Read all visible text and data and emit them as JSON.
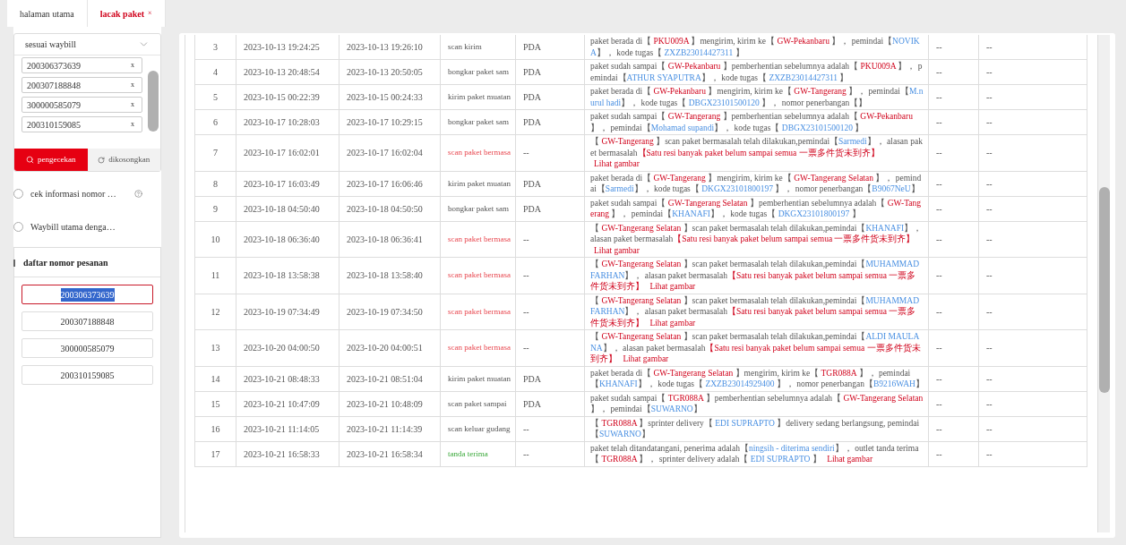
{
  "tabs": [
    {
      "label": "halaman utama",
      "selected": false
    },
    {
      "label": "lacak paket",
      "selected": true,
      "close": "×"
    }
  ],
  "sidebar": {
    "query_mode": "sesuai waybill",
    "waybill_tags": [
      {
        "label": "200306373639",
        "remove": "x"
      },
      {
        "label": "200307188848",
        "remove": "x"
      },
      {
        "label": "300000585079",
        "remove": "x"
      },
      {
        "label": "200310159085",
        "remove": "x"
      }
    ],
    "search_button": "pengecekan",
    "clear_button": "dikosongkan",
    "options": [
      {
        "label": "cek informasi nomor …",
        "selected": false,
        "help": true
      },
      {
        "label": "Waybill utama denga…",
        "selected": false,
        "help": false
      }
    ],
    "order_list": {
      "title": "daftar nomor pesanan",
      "items": [
        {
          "label": "200306373639",
          "selected": true
        },
        {
          "label": "200307188848",
          "selected": false
        },
        {
          "label": "300000585079",
          "selected": false
        },
        {
          "label": "200310159085",
          "selected": false
        }
      ]
    }
  },
  "table": {
    "rows": [
      {
        "column_1": "3",
        "column_2": "2023-10-13 19:24:25",
        "column_3": "2023-10-13 19:26:10",
        "column_4": {
          "text": "scan kirim",
          "kind": "normal"
        },
        "column_5": "PDA",
        "column_6": [
          {
            "kind": "text",
            "text": "paket berada di【 "
          },
          {
            "kind": "place",
            "text": "PKU009A"
          },
          {
            "kind": "text",
            "text": " 】mengirim, kirim ke【 "
          },
          {
            "kind": "place",
            "text": "GW-Pekanbaru"
          },
          {
            "kind": "text",
            "text": " 】， pemindai【"
          },
          {
            "kind": "person",
            "text": "NOVIKA"
          },
          {
            "kind": "text",
            "text": "】， kode tugas【 "
          },
          {
            "kind": "person",
            "text": "ZXZB23014427311"
          },
          {
            "kind": "text",
            "text": " 】"
          }
        ],
        "column_7": "--",
        "column_8": "--"
      },
      {
        "column_1": "4",
        "column_2": "2023-10-13 20:48:54",
        "column_3": "2023-10-13 20:50:05",
        "column_4": {
          "text": "bongkar paket sam",
          "kind": "normal"
        },
        "column_5": "PDA",
        "column_6": [
          {
            "kind": "text",
            "text": "paket sudah sampai【 "
          },
          {
            "kind": "place",
            "text": "GW-Pekanbaru"
          },
          {
            "kind": "text",
            "text": " 】pemberhentian sebelumnya adalah【 "
          },
          {
            "kind": "place",
            "text": "PKU009A"
          },
          {
            "kind": "text",
            "text": " 】， pemindai【"
          },
          {
            "kind": "person",
            "text": "ATHUR SYAPUTRA"
          },
          {
            "kind": "text",
            "text": "】， kode tugas【 "
          },
          {
            "kind": "person",
            "text": "ZXZB23014427311"
          },
          {
            "kind": "text",
            "text": " 】"
          }
        ],
        "column_7": "--",
        "column_8": "--"
      },
      {
        "column_1": "5",
        "column_2": "2023-10-15 00:22:39",
        "column_3": "2023-10-15 00:24:33",
        "column_4": {
          "text": "kirim paket muatan",
          "kind": "normal"
        },
        "column_5": "PDA",
        "column_6": [
          {
            "kind": "text",
            "text": "paket berada di【 "
          },
          {
            "kind": "place",
            "text": "GW-Pekanbaru"
          },
          {
            "kind": "text",
            "text": " 】mengirim, kirim ke【 "
          },
          {
            "kind": "place",
            "text": "GW-Tangerang"
          },
          {
            "kind": "text",
            "text": " 】， pemindai【"
          },
          {
            "kind": "person",
            "text": "M.nurul hadi"
          },
          {
            "kind": "text",
            "text": "】， kode tugas【 "
          },
          {
            "kind": "person",
            "text": "DBGX23101500120"
          },
          {
            "kind": "text",
            "text": " 】， nomor penerbangan【】"
          }
        ],
        "column_7": "--",
        "column_8": "--"
      },
      {
        "column_1": "6",
        "column_2": "2023-10-17 10:28:03",
        "column_3": "2023-10-17 10:29:15",
        "column_4": {
          "text": "bongkar paket sam",
          "kind": "normal"
        },
        "column_5": "PDA",
        "column_6": [
          {
            "kind": "text",
            "text": "paket sudah sampai【 "
          },
          {
            "kind": "place",
            "text": "GW-Tangerang"
          },
          {
            "kind": "text",
            "text": " 】pemberhentian sebelumnya adalah【 "
          },
          {
            "kind": "place",
            "text": "GW-Pekanbaru"
          },
          {
            "kind": "text",
            "text": " 】， pemindai【"
          },
          {
            "kind": "person",
            "text": "Mohamad supandi"
          },
          {
            "kind": "text",
            "text": "】， kode tugas【 "
          },
          {
            "kind": "person",
            "text": "DBGX23101500120"
          },
          {
            "kind": "text",
            "text": " 】"
          }
        ],
        "column_7": "--",
        "column_8": "--"
      },
      {
        "column_1": "7",
        "column_2": "2023-10-17 16:02:01",
        "column_3": "2023-10-17 16:02:04",
        "column_4": {
          "text": "scan paket bermasa",
          "kind": "problem"
        },
        "column_5": "--",
        "column_6": [
          {
            "kind": "text",
            "text": "【 "
          },
          {
            "kind": "place",
            "text": "GW-Tangerang"
          },
          {
            "kind": "text",
            "text": " 】scan paket bermasalah telah dilakukan,pemindai【"
          },
          {
            "kind": "person",
            "text": "Sarmedi"
          },
          {
            "kind": "text",
            "text": "】， alasan paket bermasalah"
          },
          {
            "kind": "reason",
            "text": "【Satu resi banyak paket belum sampai semua 一票多件货未到齐】"
          },
          {
            "kind": "link",
            "text": "Lihat gambar"
          }
        ],
        "column_7": "--",
        "column_8": "--"
      },
      {
        "column_1": "8",
        "column_2": "2023-10-17 16:03:49",
        "column_3": "2023-10-17 16:06:46",
        "column_4": {
          "text": "kirim paket muatan",
          "kind": "normal"
        },
        "column_5": "PDA",
        "column_6": [
          {
            "kind": "text",
            "text": "paket berada di【 "
          },
          {
            "kind": "place",
            "text": "GW-Tangerang"
          },
          {
            "kind": "text",
            "text": " 】mengirim, kirim ke【 "
          },
          {
            "kind": "place",
            "text": "GW-Tangerang Selatan"
          },
          {
            "kind": "text",
            "text": " 】， pemindai【"
          },
          {
            "kind": "person",
            "text": "Sarmedi"
          },
          {
            "kind": "text",
            "text": "】， kode tugas【 "
          },
          {
            "kind": "person",
            "text": "DKGX23101800197"
          },
          {
            "kind": "text",
            "text": " 】， nomor penerbangan【"
          },
          {
            "kind": "person",
            "text": "B9067NeU"
          },
          {
            "kind": "text",
            "text": "】"
          }
        ],
        "column_7": "--",
        "column_8": "--"
      },
      {
        "column_1": "9",
        "column_2": "2023-10-18 04:50:40",
        "column_3": "2023-10-18 04:50:50",
        "column_4": {
          "text": "bongkar paket sam",
          "kind": "normal"
        },
        "column_5": "PDA",
        "column_6": [
          {
            "kind": "text",
            "text": "paket sudah sampai【 "
          },
          {
            "kind": "place",
            "text": "GW-Tangerang Selatan"
          },
          {
            "kind": "text",
            "text": " 】pemberhentian sebelumnya adalah【 "
          },
          {
            "kind": "place",
            "text": "GW-Tangerang"
          },
          {
            "kind": "text",
            "text": " 】， pemindai【"
          },
          {
            "kind": "person",
            "text": "KHANAFI"
          },
          {
            "kind": "text",
            "text": "】， kode tugas【 "
          },
          {
            "kind": "person",
            "text": "DKGX23101800197"
          },
          {
            "kind": "text",
            "text": " 】"
          }
        ],
        "column_7": "--",
        "column_8": "--"
      },
      {
        "column_1": "10",
        "column_2": "2023-10-18 06:36:40",
        "column_3": "2023-10-18 06:36:41",
        "column_4": {
          "text": "scan paket bermasa",
          "kind": "problem"
        },
        "column_5": "--",
        "column_6": [
          {
            "kind": "text",
            "text": "【 "
          },
          {
            "kind": "place",
            "text": "GW-Tangerang Selatan"
          },
          {
            "kind": "text",
            "text": " 】scan paket bermasalah telah dilakukan,pemindai【"
          },
          {
            "kind": "person",
            "text": "KHANAFI"
          },
          {
            "kind": "text",
            "text": "】， alasan paket bermasalah"
          },
          {
            "kind": "reason",
            "text": "【Satu resi banyak paket belum sampai semua 一票多件货未到齐】"
          },
          {
            "kind": "link",
            "text": "Lihat gambar"
          }
        ],
        "column_7": "--",
        "column_8": "--"
      },
      {
        "column_1": "11",
        "column_2": "2023-10-18 13:58:38",
        "column_3": "2023-10-18 13:58:40",
        "column_4": {
          "text": "scan paket bermasa",
          "kind": "problem"
        },
        "column_5": "--",
        "column_6": [
          {
            "kind": "text",
            "text": "【 "
          },
          {
            "kind": "place",
            "text": "GW-Tangerang Selatan"
          },
          {
            "kind": "text",
            "text": " 】scan paket bermasalah telah dilakukan,pemindai【"
          },
          {
            "kind": "person",
            "text": "MUHAMMAD FARHAN"
          },
          {
            "kind": "text",
            "text": "】， alasan paket bermasalah"
          },
          {
            "kind": "reason",
            "text": "【Satu resi banyak paket belum sampai semua 一票多件货未到齐】"
          },
          {
            "kind": "link",
            "text": "Lihat gambar"
          }
        ],
        "column_7": "--",
        "column_8": "--"
      },
      {
        "column_1": "12",
        "column_2": "2023-10-19 07:34:49",
        "column_3": "2023-10-19 07:34:50",
        "column_4": {
          "text": "scan paket bermasa",
          "kind": "problem"
        },
        "column_5": "--",
        "column_6": [
          {
            "kind": "text",
            "text": "【 "
          },
          {
            "kind": "place",
            "text": "GW-Tangerang Selatan"
          },
          {
            "kind": "text",
            "text": " 】scan paket bermasalah telah dilakukan,pemindai【"
          },
          {
            "kind": "person",
            "text": "MUHAMMAD FARHAN"
          },
          {
            "kind": "text",
            "text": "】， alasan paket bermasalah"
          },
          {
            "kind": "reason",
            "text": "【Satu resi banyak paket belum sampai semua 一票多件货未到齐】"
          },
          {
            "kind": "link",
            "text": "Lihat gambar"
          }
        ],
        "column_7": "--",
        "column_8": "--"
      },
      {
        "column_1": "13",
        "column_2": "2023-10-20 04:00:50",
        "column_3": "2023-10-20 04:00:51",
        "column_4": {
          "text": "scan paket bermasa",
          "kind": "problem"
        },
        "column_5": "--",
        "column_6": [
          {
            "kind": "text",
            "text": "【 "
          },
          {
            "kind": "place",
            "text": "GW-Tangerang Selatan"
          },
          {
            "kind": "text",
            "text": " 】scan paket bermasalah telah dilakukan,pemindai【"
          },
          {
            "kind": "person",
            "text": "ALDI MAULANA"
          },
          {
            "kind": "text",
            "text": "】， alasan paket bermasalah"
          },
          {
            "kind": "reason",
            "text": "【Satu resi banyak paket belum sampai semua 一票多件货未到齐】"
          },
          {
            "kind": "link",
            "text": "Lihat gambar"
          }
        ],
        "column_7": "--",
        "column_8": "--"
      },
      {
        "column_1": "14",
        "column_2": "2023-10-21 08:48:33",
        "column_3": "2023-10-21 08:51:04",
        "column_4": {
          "text": "kirim paket muatan",
          "kind": "normal"
        },
        "column_5": "PDA",
        "column_6": [
          {
            "kind": "text",
            "text": "paket berada di【 "
          },
          {
            "kind": "place",
            "text": "GW-Tangerang Selatan"
          },
          {
            "kind": "text",
            "text": " 】mengirim, kirim ke【 "
          },
          {
            "kind": "place",
            "text": "TGR088A"
          },
          {
            "kind": "text",
            "text": " 】， pemindai【"
          },
          {
            "kind": "person",
            "text": "KHANAFI"
          },
          {
            "kind": "text",
            "text": "】， kode tugas【 "
          },
          {
            "kind": "person",
            "text": "ZXZB23014929400"
          },
          {
            "kind": "text",
            "text": " 】， nomor penerbangan【"
          },
          {
            "kind": "person",
            "text": "B9216WAH"
          },
          {
            "kind": "text",
            "text": "】"
          }
        ],
        "column_7": "--",
        "column_8": "--"
      },
      {
        "column_1": "15",
        "column_2": "2023-10-21 10:47:09",
        "column_3": "2023-10-21 10:48:09",
        "column_4": {
          "text": "scan paket sampai",
          "kind": "normal"
        },
        "column_5": "PDA",
        "column_6": [
          {
            "kind": "text",
            "text": "paket sudah sampai【 "
          },
          {
            "kind": "place",
            "text": "TGR088A"
          },
          {
            "kind": "text",
            "text": " 】pemberhentian sebelumnya adalah【 "
          },
          {
            "kind": "place",
            "text": "GW-Tangerang Selatan"
          },
          {
            "kind": "text",
            "text": " 】， pemindai【"
          },
          {
            "kind": "person",
            "text": "SUWARNO"
          },
          {
            "kind": "text",
            "text": "】"
          }
        ],
        "column_7": "--",
        "column_8": "--"
      },
      {
        "column_1": "16",
        "column_2": "2023-10-21 11:14:05",
        "column_3": "2023-10-21 11:14:39",
        "column_4": {
          "text": "scan keluar gudang",
          "kind": "normal"
        },
        "column_5": "--",
        "column_6": [
          {
            "kind": "text",
            "text": "【 "
          },
          {
            "kind": "place",
            "text": "TGR088A"
          },
          {
            "kind": "text",
            "text": " 】sprinter delivery【 "
          },
          {
            "kind": "person",
            "text": "EDI SUPRAPTO"
          },
          {
            "kind": "text",
            "text": " 】delivery sedang berlangsung, pemindai【"
          },
          {
            "kind": "person",
            "text": "SUWARNO"
          },
          {
            "kind": "text",
            "text": "】"
          }
        ],
        "column_7": "--",
        "column_8": "--"
      },
      {
        "column_1": "17",
        "column_2": "2023-10-21 16:58:33",
        "column_3": "2023-10-21 16:58:34",
        "column_4": {
          "text": "tanda terima",
          "kind": "signed"
        },
        "column_5": "--",
        "column_6": [
          {
            "kind": "text",
            "text": "paket telah ditandatangani, penerima adalah【"
          },
          {
            "kind": "person",
            "text": "ningsih - diterima sendiri"
          },
          {
            "kind": "text",
            "text": "】， outlet tanda terima【 "
          },
          {
            "kind": "place",
            "text": "TGR088A"
          },
          {
            "kind": "text",
            "text": " 】， sprinter delivery adalah【 "
          },
          {
            "kind": "person",
            "text": "EDI SUPRAPTO"
          },
          {
            "kind": "text",
            "text": " 】"
          },
          {
            "kind": "link",
            "text": "Lihat gambar"
          }
        ],
        "column_7": "--",
        "column_8": "--"
      }
    ]
  }
}
